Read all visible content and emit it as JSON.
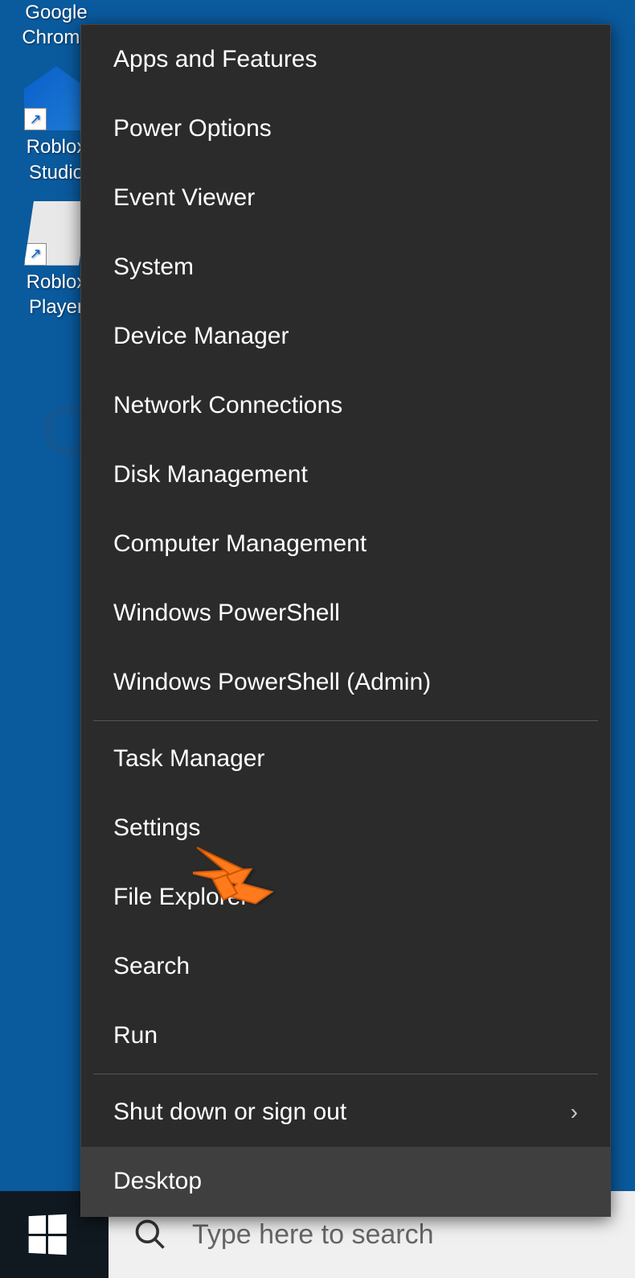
{
  "desktop": {
    "icons": [
      {
        "label": "Google\nChrome"
      },
      {
        "label": "Roblox\nStudio"
      },
      {
        "label": "Roblox\nPlayer"
      }
    ]
  },
  "context_menu": {
    "sections": [
      [
        "Apps and Features",
        "Power Options",
        "Event Viewer",
        "System",
        "Device Manager",
        "Network Connections",
        "Disk Management",
        "Computer Management",
        "Windows PowerShell",
        "Windows PowerShell (Admin)"
      ],
      [
        "Task Manager",
        "Settings",
        "File Explorer",
        "Search",
        "Run"
      ],
      [
        "Shut down or sign out",
        "Desktop"
      ]
    ],
    "submenu_items": [
      "Shut down or sign out"
    ],
    "highlighted": "Desktop",
    "pointed_at": "Settings"
  },
  "taskbar": {
    "search_placeholder": "Type here to search"
  },
  "watermark_text": "COM"
}
